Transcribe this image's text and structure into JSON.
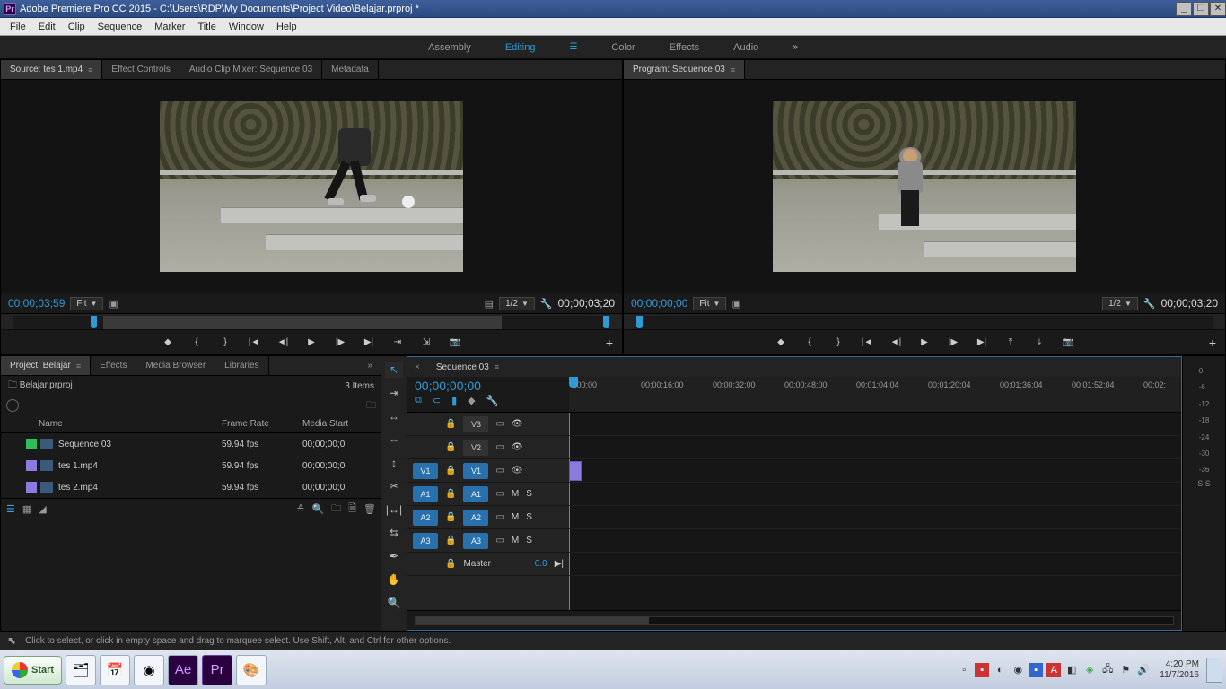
{
  "title": "Adobe Premiere Pro CC 2015 - C:\\Users\\RDP\\My Documents\\Project Video\\Belajar.prproj *",
  "menu": [
    "File",
    "Edit",
    "Clip",
    "Sequence",
    "Marker",
    "Title",
    "Window",
    "Help"
  ],
  "workspaces": [
    "Assembly",
    "Editing",
    "Color",
    "Effects",
    "Audio"
  ],
  "workspace_active": "Editing",
  "source": {
    "tabs": [
      "Source: tes 1.mp4",
      "Effect Controls",
      "Audio Clip Mixer: Sequence 03",
      "Metadata"
    ],
    "tc_left": "00;00;03;59",
    "fit": "Fit",
    "res": "1/2",
    "tc_right": "00;00;03;20"
  },
  "program": {
    "tab": "Program: Sequence 03",
    "tc_left": "00;00;00;00",
    "fit": "Fit",
    "res": "1/2",
    "tc_right": "00;00;03;20"
  },
  "project": {
    "tabs": [
      "Project: Belajar",
      "Effects",
      "Media Browser",
      "Libraries"
    ],
    "file": "Belajar.prproj",
    "count": "3 Items",
    "cols": [
      "Name",
      "Frame Rate",
      "Media Start"
    ],
    "rows": [
      {
        "chip": "#2fbf5a",
        "name": "Sequence 03",
        "fr": "59.94 fps",
        "ms": "00;00;00;0"
      },
      {
        "chip": "#8c7bdf",
        "name": "tes 1.mp4",
        "fr": "59.94 fps",
        "ms": "00;00;00;0"
      },
      {
        "chip": "#8c7bdf",
        "name": "tes 2.mp4",
        "fr": "59.94 fps",
        "ms": "00;00;00;0"
      }
    ]
  },
  "timeline": {
    "tab": "Sequence 03",
    "tc": "00;00;00;00",
    "ticks": [
      ";00;00",
      "00;00;16;00",
      "00;00;32;00",
      "00;00;48;00",
      "00;01;04;04",
      "00;01;20;04",
      "00;01;36;04",
      "00;01;52;04",
      "00;02;"
    ],
    "tracks_v": [
      "V3",
      "V2",
      "V1"
    ],
    "tracks_a": [
      "A1",
      "A2",
      "A3"
    ],
    "src_v": "V1",
    "src_a": [
      "A1",
      "A2",
      "A3"
    ],
    "master": "Master",
    "master_val": "0.0"
  },
  "status": "Click to select, or click in empty space and drag to marquee select. Use Shift, Alt, and Ctrl for other options.",
  "taskbar": {
    "start": "Start",
    "time": "4:20 PM",
    "date": "11/7/2016"
  },
  "meter_scale": [
    "0",
    "-6",
    "-12",
    "-18",
    "-24",
    "-30",
    "-36"
  ]
}
